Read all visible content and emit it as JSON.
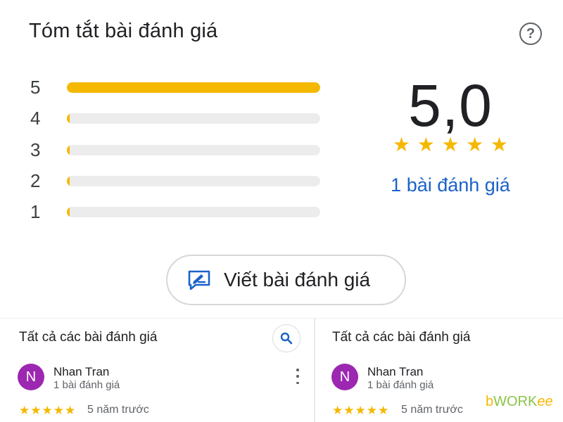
{
  "summary": {
    "title": "Tóm tắt bài đánh giá",
    "help_icon": "help-circle-icon",
    "rating_rows": [
      {
        "label": "5",
        "fraction": 1.0
      },
      {
        "label": "4",
        "fraction": 0.0
      },
      {
        "label": "3",
        "fraction": 0.0
      },
      {
        "label": "2",
        "fraction": 0.0
      },
      {
        "label": "1",
        "fraction": 0.0
      }
    ],
    "average": "5,0",
    "stars": 5,
    "review_count": "1 bài đánh giá"
  },
  "write_review": {
    "label": "Viết bài đánh giá",
    "icon": "write-review-icon"
  },
  "panels": [
    {
      "title": "Tất cả các bài đánh giá",
      "has_search": true,
      "search_icon": "search-icon",
      "review": {
        "avatar_letter": "N",
        "name": "Nhan Tran",
        "subtitle": "1 bài đánh giá",
        "stars": "★★★★★",
        "time": "5 năm trước"
      }
    },
    {
      "title": "Tất cả các bài đánh giá",
      "has_search": false,
      "review": {
        "avatar_letter": "N",
        "name": "Nhan Tran",
        "subtitle": "1 bài đánh giá",
        "stars": "★★★★★",
        "time": "5 năm trước"
      }
    }
  ],
  "watermark": {
    "b": "b",
    "work": "WORK",
    "ee": "ee"
  },
  "colors": {
    "star": "#f5b800",
    "link": "#1a62c9",
    "avatar": "#9c27b0",
    "track": "#ececec"
  }
}
